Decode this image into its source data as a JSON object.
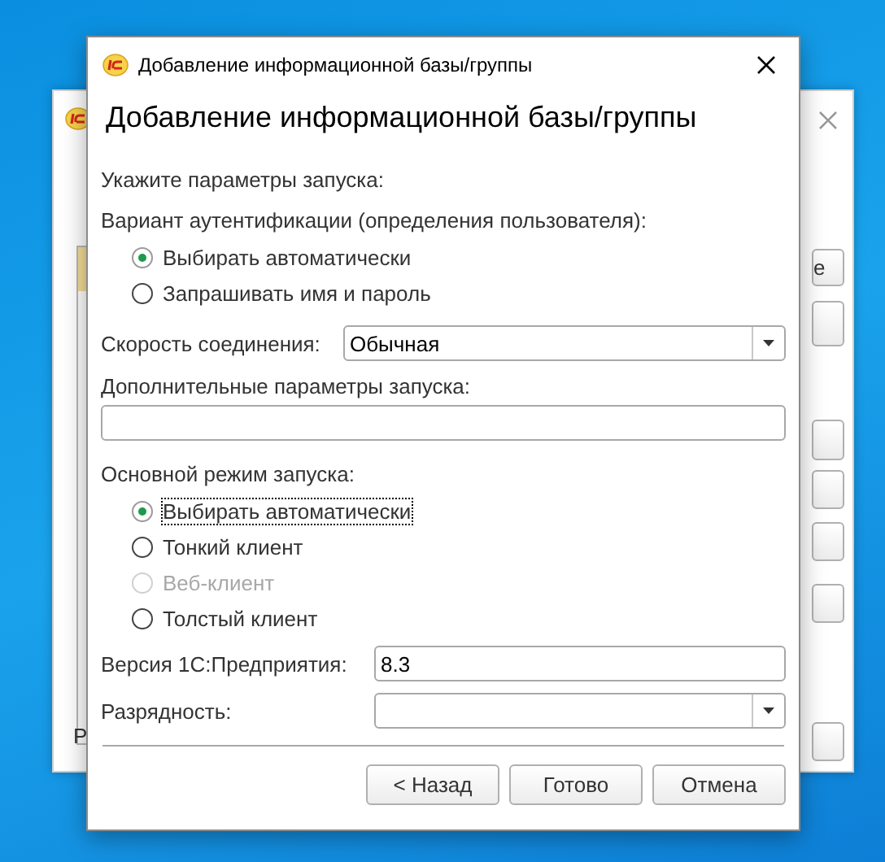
{
  "back_window": {
    "button_text": "е",
    "footer_text": "Р"
  },
  "dialog": {
    "title": "Добавление информационной базы/группы",
    "heading": "Добавление информационной базы/группы"
  },
  "intro": "Укажите параметры запуска:",
  "auth": {
    "label": "Вариант аутентификации (определения пользователя):",
    "options": [
      {
        "label": "Выбирать автоматически",
        "selected": true,
        "disabled": false,
        "focused": false
      },
      {
        "label": "Запрашивать имя и пароль",
        "selected": false,
        "disabled": false,
        "focused": false
      }
    ]
  },
  "speed": {
    "label": "Скорость соединения:",
    "value": "Обычная"
  },
  "extra_params": {
    "label": "Дополнительные параметры запуска:"
  },
  "mode": {
    "label": "Основной режим запуска:",
    "options": [
      {
        "label": "Выбирать автоматически",
        "selected": true,
        "disabled": false,
        "focused": true
      },
      {
        "label": "Тонкий клиент",
        "selected": false,
        "disabled": false,
        "focused": false
      },
      {
        "label": "Веб-клиент",
        "selected": false,
        "disabled": true,
        "focused": false
      },
      {
        "label": "Толстый клиент",
        "selected": false,
        "disabled": false,
        "focused": false
      }
    ]
  },
  "version": {
    "label": "Версия 1С:Предприятия:",
    "value": "8.3"
  },
  "bitness": {
    "label": "Разрядность:"
  },
  "buttons": [
    "< Назад",
    "Готово",
    "Отмена"
  ]
}
